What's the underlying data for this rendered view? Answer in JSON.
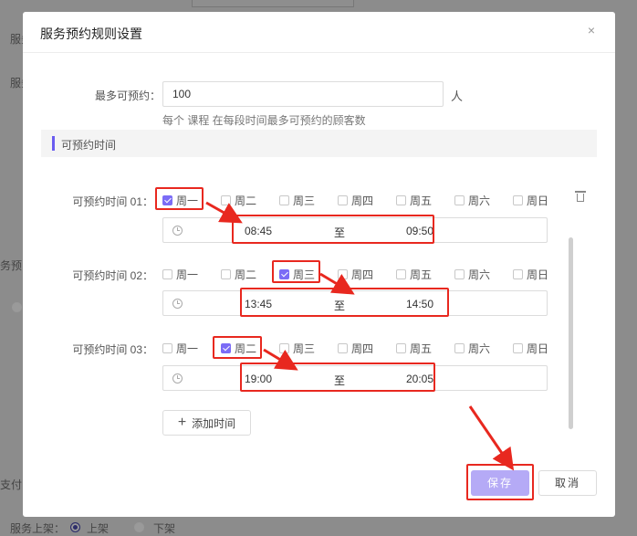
{
  "background": {
    "label_a": "服务",
    "label_b": "服务",
    "label_c": "务预",
    "label_d": "支付",
    "shelf_label": "服务上架：",
    "shelf_on": "上架",
    "shelf_off": "下架"
  },
  "dialog": {
    "title": "服务预约规则设置",
    "close_icon": "×",
    "max_label": "最多可预约：",
    "max_value": "100",
    "max_unit": "人",
    "max_hint": "每个 课程 在每段时间最多可预约的顾客数",
    "section_title": "可预约时间",
    "weekdays": [
      "周一",
      "周二",
      "周三",
      "周四",
      "周五",
      "周六",
      "周日"
    ],
    "slots": [
      {
        "label": "可预约时间 01：",
        "checked_day": "周一",
        "start": "08:45",
        "sep": "至",
        "end": "09:50"
      },
      {
        "label": "可预约时间 02：",
        "checked_day": "周三",
        "start": "13:45",
        "sep": "至",
        "end": "14:50"
      },
      {
        "label": "可预约时间 03：",
        "checked_day": "周二",
        "start": "19:00",
        "sep": "至",
        "end": "20:05"
      }
    ],
    "add_button": "添加时间",
    "add_icon": "+",
    "save_button": "保存",
    "cancel_button": "取消"
  },
  "colors": {
    "accent": "#7b6cf6",
    "save_bg": "#b5aaf6",
    "highlight": "#e8281f"
  }
}
